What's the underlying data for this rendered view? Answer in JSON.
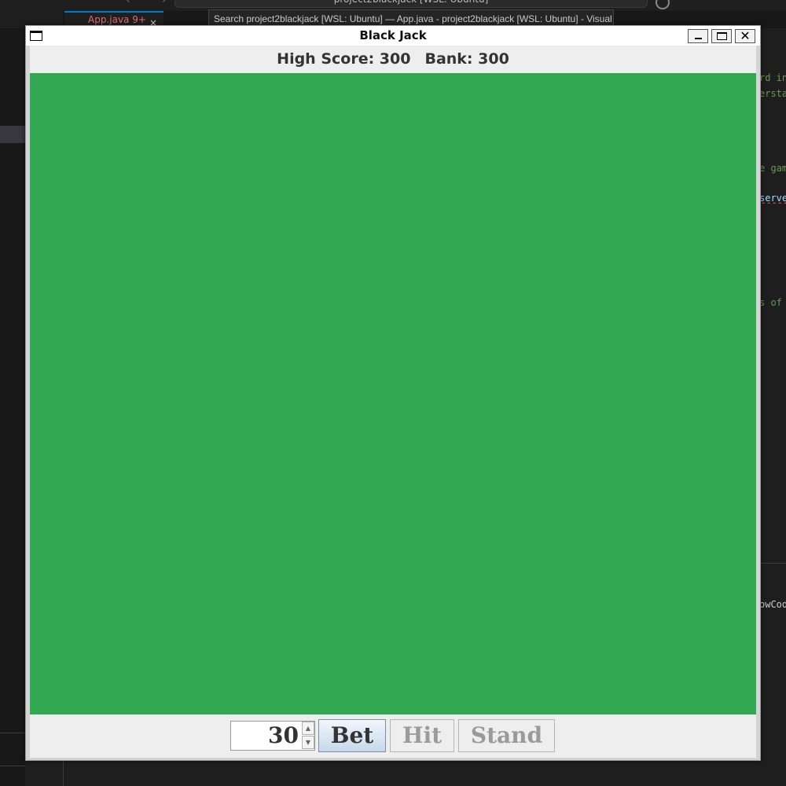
{
  "background": {
    "nav_arrows": "‹ ›",
    "command_center": "project2blackjack [WSL: Ubuntu]",
    "tab_label": "App.java 9+",
    "tab_close": "×",
    "tooltip": "Search project2blackjack [WSL: Ubuntu] — App.java - project2blackjack [WSL: Ubuntu] - Visual",
    "code_fragments": [
      "rd in",
      "ersta",
      "e gam",
      "serve",
      "s of",
      "owCod"
    ],
    "colors": {
      "editor_bg": "#1e1e1e",
      "code_green": "#6a9955",
      "code_blue": "#9cdcfe"
    }
  },
  "window": {
    "title": "Black Jack",
    "minimize_icon": "minimize-icon",
    "maximize_icon": "maximize-icon",
    "close_icon": "close-icon",
    "close_glyph": "✕"
  },
  "score": {
    "high_score_text": "High Score: 300",
    "bank_text": "Bank: 300"
  },
  "table": {
    "felt_color": "#33a853"
  },
  "controls": {
    "bet_amount": "30",
    "spin_up": "▲",
    "spin_down": "▼",
    "bet_label": "Bet",
    "hit_label": "Hit",
    "stand_label": "Stand",
    "hit_enabled": false,
    "stand_enabled": false
  }
}
